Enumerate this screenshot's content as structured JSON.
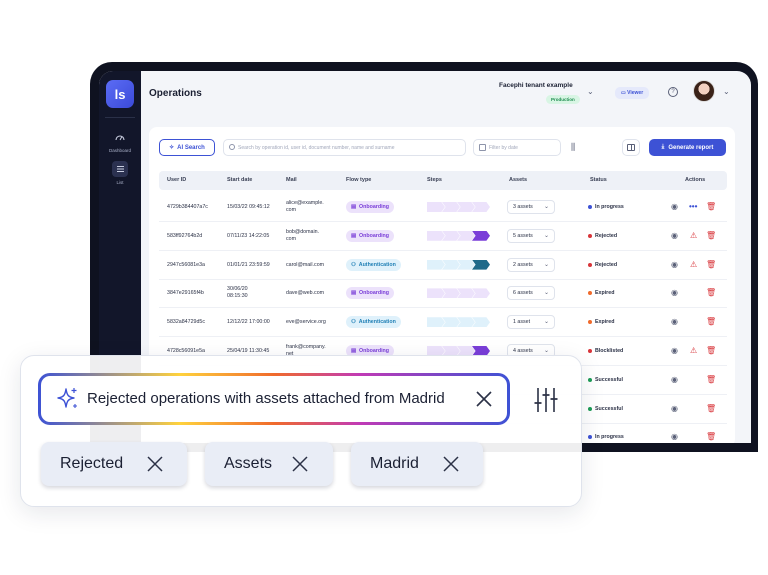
{
  "app": {
    "logo_text": "ls",
    "sidebar": [
      {
        "label": "Dashboard",
        "icon": "gauge-icon"
      },
      {
        "label": "List",
        "icon": "list-icon"
      }
    ]
  },
  "header": {
    "title": "Operations",
    "tenant": "Facephi tenant example",
    "environment": "Production",
    "role": "Viewer"
  },
  "toolbar": {
    "ai_search_label": "AI Search",
    "search_placeholder": "Search by operation id, user id, document number, name and surname",
    "date_placeholder": "Filter by date",
    "generate_report_label": "Generate report"
  },
  "table": {
    "columns": [
      "User ID",
      "Start date",
      "Mail",
      "Flow type",
      "Steps",
      "Assets",
      "Status",
      "Actions"
    ],
    "rows": [
      {
        "user_id": "4729b384407a7c",
        "start_date": "15/03/22 09:45:12",
        "mail_1": "alice@example.",
        "mail_2": "com",
        "flow": "Onboarding",
        "assets": "3 assets",
        "status": "In progress",
        "status_color": "#3d52d5",
        "warning": false
      },
      {
        "user_id": "583ff92764b2d",
        "start_date": "07/11/23 14:22:05",
        "mail_1": "bob@domain.",
        "mail_2": "com",
        "flow": "Onboarding",
        "assets": "5 assets",
        "status": "Rejected",
        "status_color": "#d8353a",
        "warning": true
      },
      {
        "user_id": "2947c56081e3a",
        "start_date": "01/01/21 23:59:59",
        "mail_1": "carol@mail.com",
        "mail_2": "",
        "flow": "Authentication",
        "assets": "2 assets",
        "status": "Rejected",
        "status_color": "#d8353a",
        "warning": true
      },
      {
        "user_id": "3847e29165f4b",
        "start_date_1": "30/06/20",
        "start_date": "30/06/20",
        "start_date_2": "08:15:30",
        "mail_1": "dave@web.com",
        "mail_2": "",
        "flow": "Onboarding",
        "assets": "6 assets",
        "status": "Expired",
        "status_color": "#f06a2b",
        "warning": false
      },
      {
        "user_id": "5832a84729d5c",
        "start_date": "12/12/22 17:00:00",
        "mail_1": "eve@service.org",
        "mail_2": "",
        "flow": "Authentication",
        "assets": "1 asset",
        "status": "Expired",
        "status_color": "#f06a2b",
        "warning": false
      },
      {
        "user_id": "4728c56091e5a",
        "start_date": "25/04/19 11:30:45",
        "mail_1": "frank@company.",
        "mail_2": "net",
        "flow": "Onboarding",
        "assets": "4 assets",
        "status": "Blocklisted",
        "status_color": "#d8353a",
        "warning": true
      },
      {
        "user_id": "",
        "start_date": "",
        "mail_1": "",
        "mail_2": "",
        "flow": "",
        "assets": "",
        "status": "Successful",
        "status_color": "#1c9c55",
        "warning": false
      },
      {
        "user_id": "",
        "start_date": "",
        "mail_1": "",
        "mail_2": "",
        "flow": "",
        "assets": "",
        "status": "Successful",
        "status_color": "#1c9c55",
        "warning": false
      },
      {
        "user_id": "",
        "start_date": "",
        "mail_1": "",
        "mail_2": "",
        "flow": "",
        "assets": "",
        "status": "In progress",
        "status_color": "#3d52d5",
        "warning": false
      }
    ]
  },
  "ai_panel": {
    "query": "Rejected operations with assets attached from Madrid",
    "chips": [
      "Rejected",
      "Assets",
      "Madrid"
    ]
  },
  "colors": {
    "accent": "#3d52d5",
    "sidebar": "#12162a",
    "danger": "#d8353a"
  }
}
